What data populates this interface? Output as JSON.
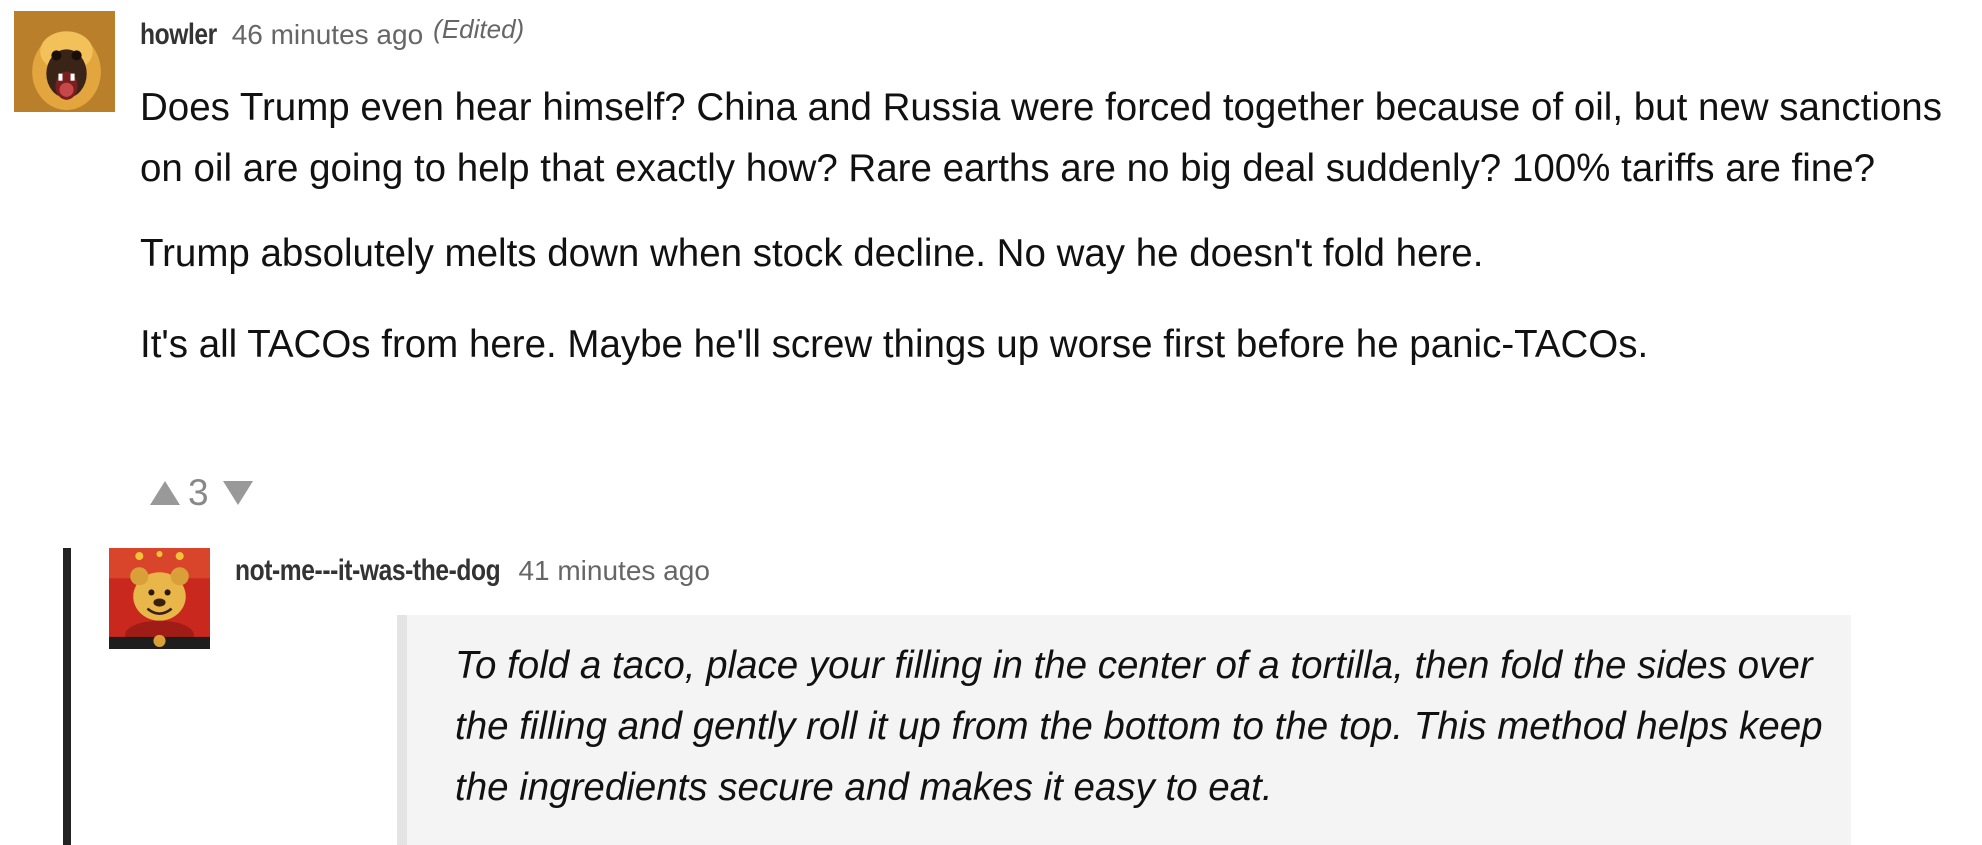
{
  "comments": [
    {
      "username": "howler",
      "timestamp": "46 minutes ago",
      "edited": "(Edited)",
      "avatar": "monkey-avatar",
      "paragraphs": [
        "Does Trump even hear himself? China and Russia were forced together because of oil, but new sanctions on oil are going to help that exactly how? Rare earths are no big deal suddenly? 100% tariffs are fine?",
        "Trump absolutely melts down when stock decline. No way he doesn't fold here.",
        "It's all TACOs from here. Maybe he'll screw things up worse first before he panic-TACOs."
      ],
      "votes": {
        "count": "3",
        "up_icon": "triangle-up-icon",
        "down_icon": "triangle-down-icon"
      }
    },
    {
      "username": "not-me---it-was-the-dog",
      "timestamp": "41 minutes ago",
      "avatar": "winnie-the-pooh-avatar",
      "quote": "To fold a taco, place your filling in the center of a tortilla, then fold the sides over the filling and gently roll it up from the bottom to the top. This method helps keep the ingredients secure and makes it easy to eat."
    }
  ],
  "colors": {
    "text": "#111111",
    "meta": "#666666",
    "vote": "#999999",
    "thread_line": "#222222",
    "quote_bg": "#f4f4f4"
  }
}
